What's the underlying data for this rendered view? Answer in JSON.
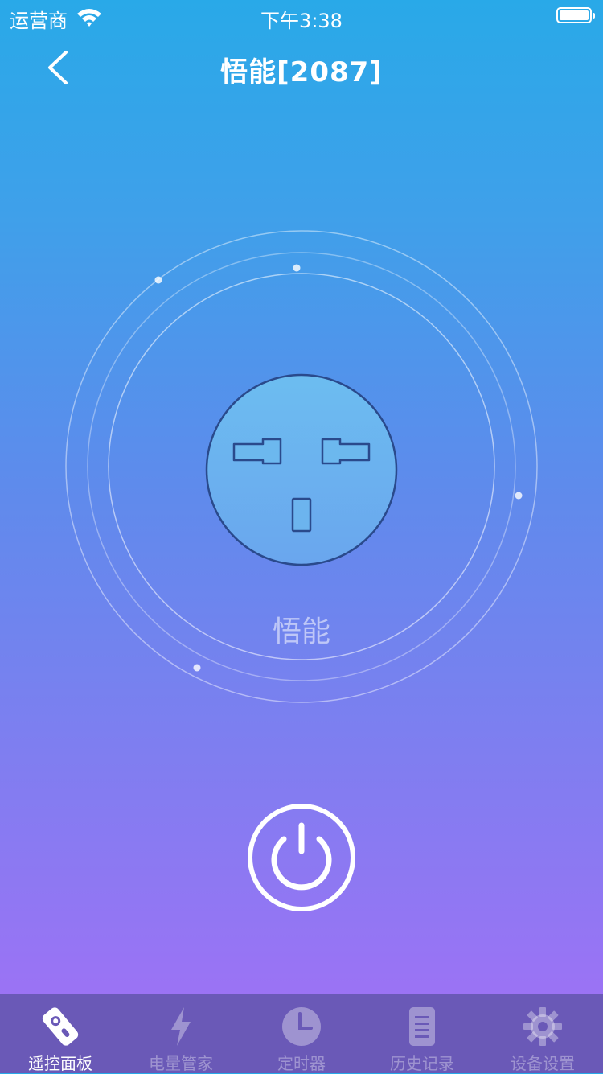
{
  "status_bar": {
    "carrier": "运营商",
    "time": "下午3:38",
    "battery": "full"
  },
  "nav": {
    "title": "悟能[2087]",
    "back_icon": "chevron-left-icon"
  },
  "device": {
    "name": "悟能",
    "socket_icon": "power-socket-icon",
    "power_icon": "power-icon"
  },
  "colors": {
    "gradient_top": "#29a9e8",
    "gradient_bottom": "#a46ff6",
    "socket_fill": "#6cb8ee",
    "socket_outline": "#2a4a8c",
    "tab_bar": "#6a59b7"
  },
  "tabs": [
    {
      "label": "遥控面板",
      "icon": "remote-icon",
      "active": true
    },
    {
      "label": "电量管家",
      "icon": "lightning-icon",
      "active": false
    },
    {
      "label": "定时器",
      "icon": "clock-icon",
      "active": false
    },
    {
      "label": "历史记录",
      "icon": "document-list-icon",
      "active": false
    },
    {
      "label": "设备设置",
      "icon": "gear-icon",
      "active": false
    }
  ]
}
